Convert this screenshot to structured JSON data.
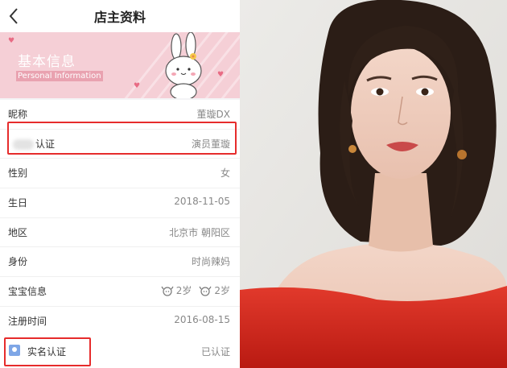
{
  "navbar": {
    "title": "店主资料"
  },
  "banner": {
    "title": "基本信息",
    "subtitle": "Personal Information"
  },
  "rows": [
    {
      "label": "昵称",
      "value": "董璇DX"
    },
    {
      "label": "认证",
      "value": "演员董璇"
    },
    {
      "label": "性别",
      "value": "女"
    },
    {
      "label": "生日",
      "value": "2018-11-05"
    },
    {
      "label": "地区",
      "value": "北京市 朝阳区"
    },
    {
      "label": "身份",
      "value": "时尚辣妈"
    }
  ],
  "baby": {
    "label": "宝宝信息",
    "ages": [
      "2岁",
      "2岁"
    ]
  },
  "register": {
    "label": "注册时间",
    "value": "2016-08-15"
  },
  "realname": {
    "label": "实名认证",
    "value": "已认证"
  },
  "colors": {
    "highlight_box": "#e62c2c",
    "banner_pink": "#f5cfd6",
    "dress_red": "#d9261c"
  },
  "icons": [
    "back-chevron-icon",
    "bunny-sticker",
    "baby-face-icon",
    "id-card-icon"
  ]
}
